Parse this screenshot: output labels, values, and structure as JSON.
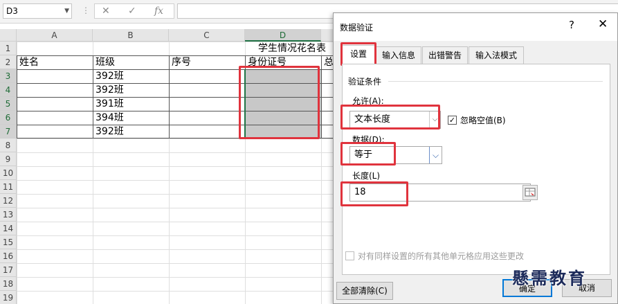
{
  "formula_bar": {
    "name_box": "D3",
    "cancel_icon": "✕",
    "enter_icon": "✓",
    "fx_label": "fx",
    "formula": ""
  },
  "columns": [
    "A",
    "B",
    "C",
    "D"
  ],
  "rows": [
    "1",
    "2",
    "3",
    "4",
    "5",
    "6",
    "7",
    "8",
    "9",
    "10",
    "11",
    "12",
    "13",
    "14",
    "15",
    "16",
    "17",
    "18",
    "19"
  ],
  "sheet": {
    "title": "学生情况花名表",
    "headers": [
      "姓名",
      "班级",
      "序号",
      "身份证号",
      "总"
    ],
    "class_values": [
      "392班",
      "392班",
      "391班",
      "394班",
      "392班"
    ]
  },
  "dialog": {
    "title": "数据验证",
    "help_icon": "?",
    "close_icon": "✕",
    "tabs": [
      "设置",
      "输入信息",
      "出错警告",
      "输入法模式"
    ],
    "group_label": "验证条件",
    "allow_label": "允许(A):",
    "allow_value": "文本长度",
    "ignore_blank_label": "忽略空值(B)",
    "data_label": "数据(D):",
    "data_value": "等于",
    "length_label": "长度(L)",
    "length_value": "18",
    "apply_all_label": "对有同样设置的所有其他单元格应用这些更改",
    "clear_all_button": "全部清除(C)",
    "ok_button": "确定",
    "cancel_button": "取消"
  },
  "watermark": "懸需教育"
}
